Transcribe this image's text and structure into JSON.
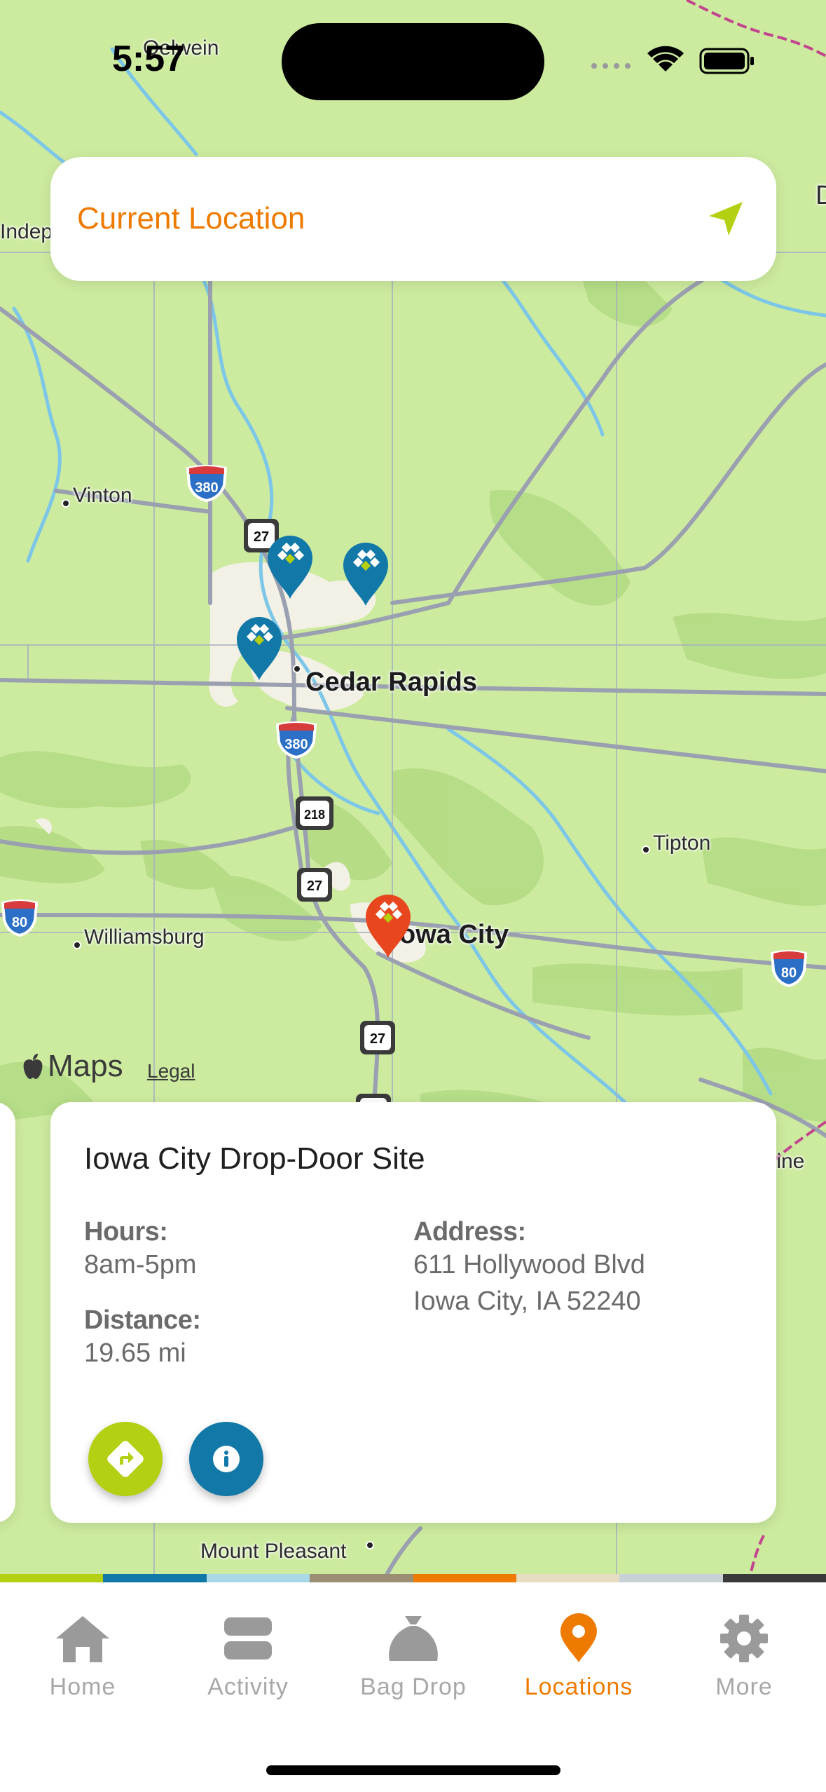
{
  "status_bar": {
    "time": "5:57"
  },
  "search": {
    "current_location_label": "Current Location",
    "locate_icon": "location-arrow-icon"
  },
  "map": {
    "labels": {
      "oelwein": "Oelwein",
      "indep": "Indep",
      "vinton": "Vinton",
      "cedar_rapids": "Cedar Rapids",
      "tipton": "Tipton",
      "williamsburg": "Williamsburg",
      "iowa_city": "owa City",
      "mount_pleasant": "Mount Pleasant",
      "edge_d": "D",
      "edge_tine": "tine"
    },
    "shields": {
      "i380_a": "380",
      "i380_b": "380",
      "us27_a": "27",
      "us27_b": "27",
      "us27_c": "27",
      "us218": "218",
      "i80_a": "80",
      "i80_b": "80"
    },
    "attribution": {
      "brand": "Maps",
      "legal": "Legal"
    },
    "colors": {
      "land": "#cdeb9f",
      "forest": "#b4db84",
      "water": "#7cc6e8",
      "road": "#9aa0b0",
      "pin_default": "#1178a8",
      "pin_selected": "#e8461e"
    }
  },
  "site_card": {
    "name": "Iowa City Drop-Door Site",
    "hours_label": "Hours:",
    "hours_value": "8am-5pm",
    "distance_label": "Distance:",
    "distance_value": "19.65 mi",
    "address_label": "Address:",
    "address_line1": "611 Hollywood Blvd",
    "address_line2": "Iowa City, IA 52240",
    "directions_icon": "directions-icon",
    "info_icon": "info-icon"
  },
  "brand_stripe": [
    "#b5cf12",
    "#1178a8",
    "#a9d8e6",
    "#9a8f72",
    "#ee7a00",
    "#e6dcc0",
    "#c8d2d6",
    "#3a3a3a"
  ],
  "tabs": [
    {
      "label": "Home",
      "icon": "home-icon"
    },
    {
      "label": "Activity",
      "icon": "activity-icon"
    },
    {
      "label": "Bag Drop",
      "icon": "bag-icon"
    },
    {
      "label": "Locations",
      "icon": "location-pin-icon",
      "active": true
    },
    {
      "label": "More",
      "icon": "gear-icon"
    }
  ]
}
